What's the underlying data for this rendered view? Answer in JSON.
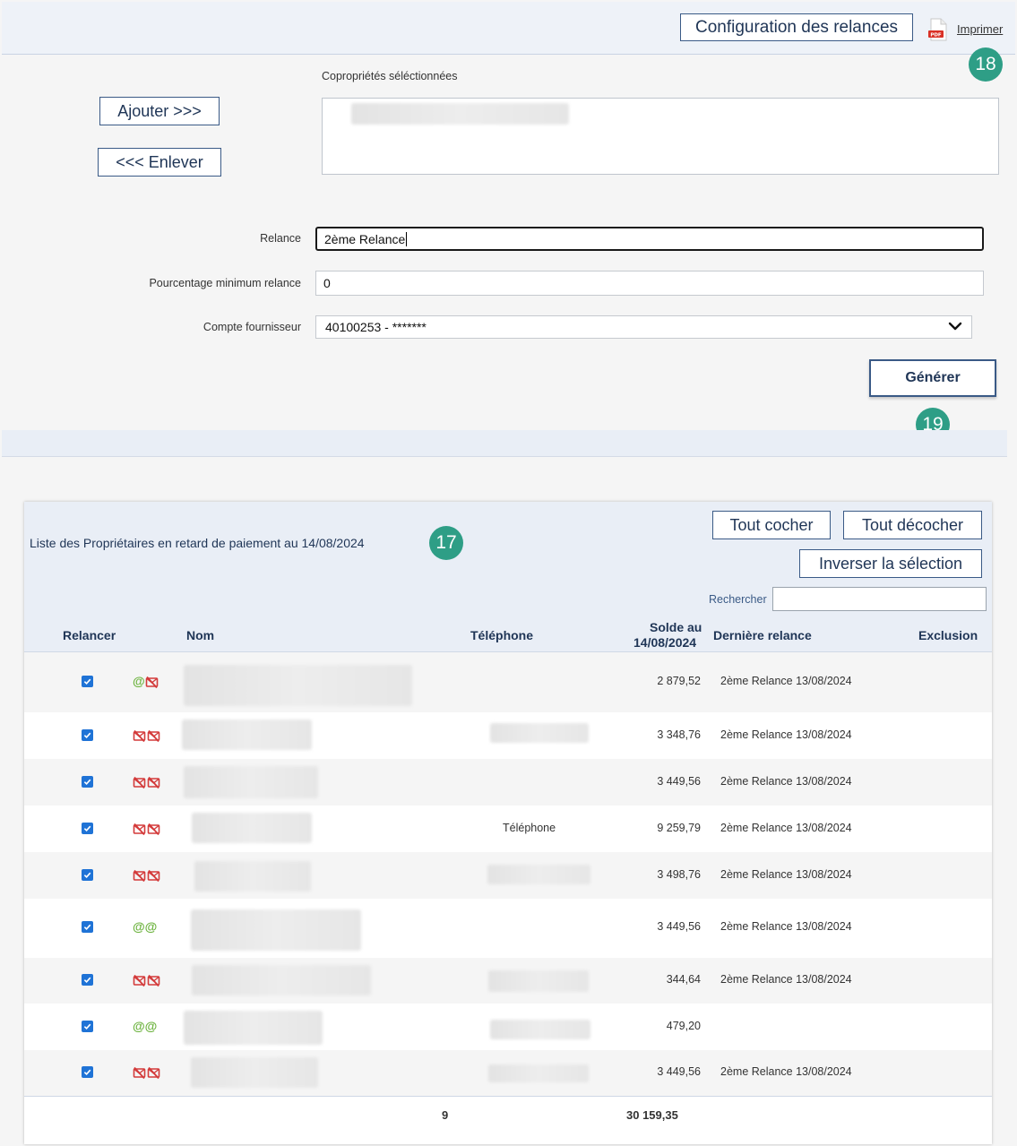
{
  "toolbar": {
    "config_label": "Configuration des relances",
    "print_label": "Imprimer",
    "pdf_icon": "pdf-icon",
    "badge_print": "18"
  },
  "selection": {
    "copro_label": "Copropriétés séléctionnées",
    "add_label": "Ajouter >>>",
    "remove_label": "<<< Enlever"
  },
  "form": {
    "relance_label": "Relance",
    "relance_value": "2ème Relance",
    "min_pct_label": "Pourcentage minimum relance",
    "min_pct_value": "0",
    "supplier_label": "Compte fournisseur",
    "supplier_value": "40100253 - *******",
    "generate_label": "Générer",
    "badge_generate": "19"
  },
  "list": {
    "title": "Liste des Propriétaires en retard de paiement au 14/08/2024",
    "badge_list": "17",
    "check_all": "Tout cocher",
    "uncheck_all": "Tout décocher",
    "invert": "Inverser la sélection",
    "search_label": "Rechercher",
    "columns": {
      "relancer": "Relancer",
      "nom": "Nom",
      "telephone": "Téléphone",
      "solde_line1": "Solde au",
      "solde_line2": "14/08/2024",
      "derniere": "Dernière relance",
      "exclusion": "Exclusion"
    },
    "rows": [
      {
        "checked": true,
        "icons": [
          "email",
          "no-mail"
        ],
        "telephone": "",
        "solde": "2 879,52",
        "derniere": "2ème Relance 13/08/2024"
      },
      {
        "checked": true,
        "icons": [
          "no-email",
          "no-mail"
        ],
        "telephone": "",
        "solde": "3 348,76",
        "derniere": "2ème Relance 13/08/2024"
      },
      {
        "checked": true,
        "icons": [
          "no-email",
          "no-mail"
        ],
        "telephone": "",
        "solde": "3 449,56",
        "derniere": "2ème Relance 13/08/2024"
      },
      {
        "checked": true,
        "icons": [
          "no-email",
          "no-mail"
        ],
        "telephone": "Téléphone",
        "solde": "9 259,79",
        "derniere": "2ème Relance 13/08/2024"
      },
      {
        "checked": true,
        "icons": [
          "no-email",
          "no-mail"
        ],
        "telephone": "",
        "solde": "3 498,76",
        "derniere": "2ème Relance 13/08/2024"
      },
      {
        "checked": true,
        "icons": [
          "email",
          "email"
        ],
        "telephone": "",
        "solde": "3 449,56",
        "derniere": "2ème Relance 13/08/2024"
      },
      {
        "checked": true,
        "icons": [
          "no-email",
          "no-mail"
        ],
        "telephone": "",
        "solde": "344,64",
        "derniere": "2ème Relance 13/08/2024"
      },
      {
        "checked": true,
        "icons": [
          "email",
          "email"
        ],
        "telephone": "",
        "solde": "479,20",
        "derniere": ""
      },
      {
        "checked": true,
        "icons": [
          "no-email",
          "no-mail"
        ],
        "telephone": "",
        "solde": "3 449,56",
        "derniere": "2ème Relance 13/08/2024"
      }
    ],
    "footer": {
      "count": "9",
      "total": "30 159,35"
    }
  },
  "colors": {
    "accent": "#2e9e86",
    "button_border": "#3a5a86",
    "email_green": "#6db33f",
    "no_email_red": "#d33a3a",
    "checkbox_blue": "#1f73d6"
  }
}
